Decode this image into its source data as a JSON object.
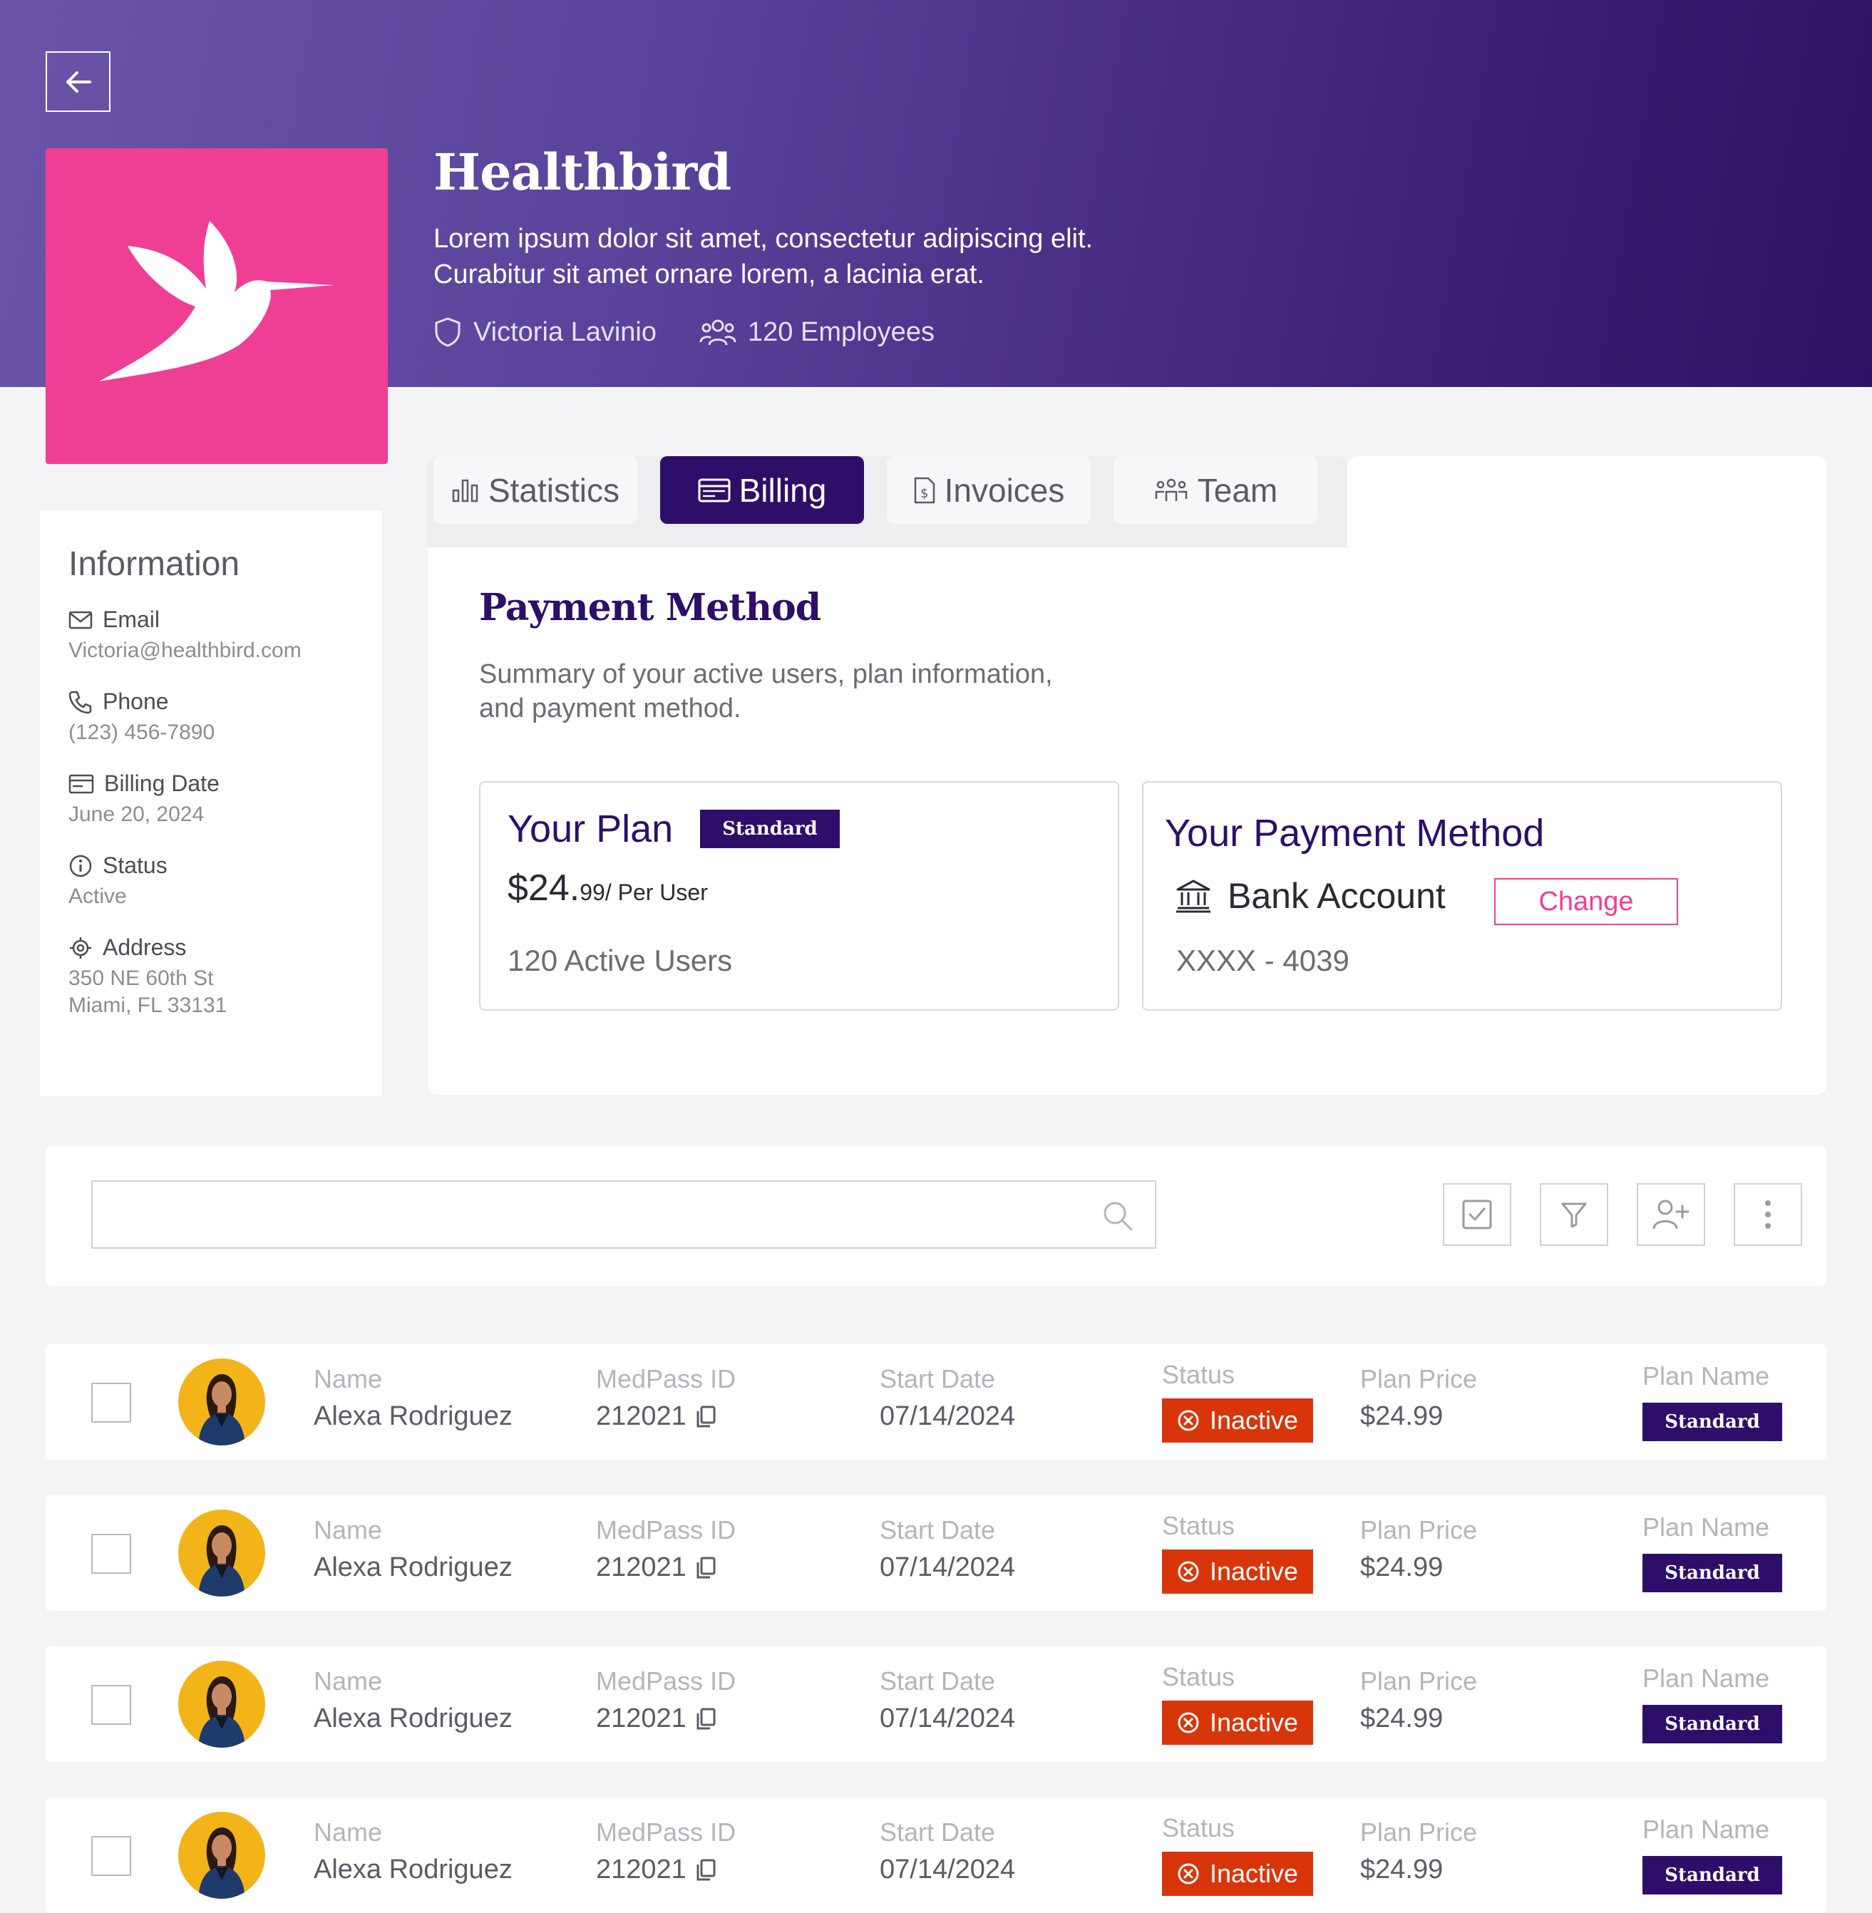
{
  "company": {
    "name": "Healthbird",
    "description_line1": "Lorem ipsum dolor sit amet, consectetur adipiscing elit.",
    "description_line2": "Curabitur sit amet ornare lorem, a lacinia erat.",
    "owner": "Victoria Lavinio",
    "employees": "120 Employees"
  },
  "information": {
    "title": "Information",
    "items": [
      {
        "label": "Email",
        "value": "Victoria@healthbird.com",
        "icon": "mail-icon"
      },
      {
        "label": "Phone",
        "value": "(123) 456-7890",
        "icon": "phone-icon"
      },
      {
        "label": "Billing Date",
        "value": "June 20, 2024",
        "icon": "credit-card-icon"
      },
      {
        "label": "Status",
        "value": "Active",
        "icon": "info-icon"
      },
      {
        "label": "Address",
        "value": "350 NE 60th St",
        "value2": "Miami, FL 33131",
        "icon": "location-icon"
      }
    ]
  },
  "tabs": [
    {
      "label": "Statistics",
      "icon": "bar-chart-icon"
    },
    {
      "label": "Billing",
      "icon": "credit-card-icon",
      "active": true
    },
    {
      "label": "Invoices",
      "icon": "invoice-icon"
    },
    {
      "label": "Team",
      "icon": "team-icon"
    }
  ],
  "billing": {
    "title": "Payment Method",
    "subtitle_line1": "Summary of your active users, plan information,",
    "subtitle_line2": "and payment method.",
    "plan": {
      "title": "Your Plan",
      "badge": "Standard",
      "price": "$24.",
      "price_cents": "99",
      "price_unit": "/ Per User",
      "active_users": "120 Active Users"
    },
    "payment_method": {
      "title": "Your Payment Method",
      "type": "Bank Account",
      "change_label": "Change",
      "account": "XXXX - 4039"
    }
  },
  "search": {
    "placeholder": "",
    "value": ""
  },
  "table": {
    "columns": {
      "name": "Name",
      "medpass": "MedPass ID",
      "start": "Start Date",
      "status": "Status",
      "price": "Plan Price",
      "plan": "Plan Name"
    },
    "rows": [
      {
        "name": "Alexa Rodriguez",
        "medpass": "212021",
        "start": "07/14/2024",
        "status": "Inactive",
        "price": "$24.99",
        "plan": "Standard"
      },
      {
        "name": "Alexa Rodriguez",
        "medpass": "212021",
        "start": "07/14/2024",
        "status": "Inactive",
        "price": "$24.99",
        "plan": "Standard"
      },
      {
        "name": "Alexa Rodriguez",
        "medpass": "212021",
        "start": "07/14/2024",
        "status": "Inactive",
        "price": "$24.99",
        "plan": "Standard"
      },
      {
        "name": "Alexa Rodriguez",
        "medpass": "212021",
        "start": "07/14/2024",
        "status": "Inactive",
        "price": "$24.99",
        "plan": "Standard"
      }
    ]
  },
  "colors": {
    "brand_pink": "#ef3f94",
    "brand_purple": "#2d0f69",
    "inactive_red": "#d8360a"
  }
}
